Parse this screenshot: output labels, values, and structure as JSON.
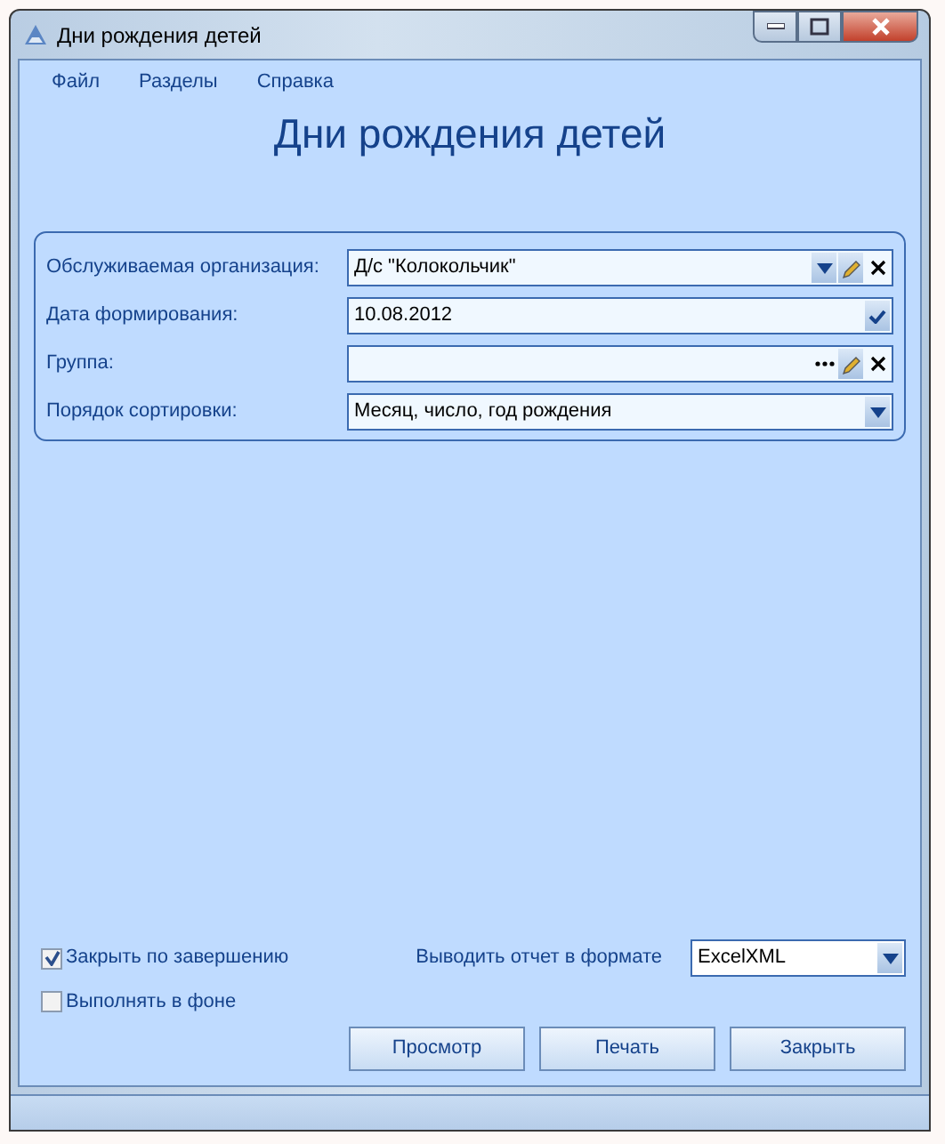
{
  "window": {
    "title": "Дни рождения детей"
  },
  "menu": [
    {
      "label": "Файл"
    },
    {
      "label": "Разделы"
    },
    {
      "label": "Справка"
    }
  ],
  "heading": "Дни рождения детей",
  "fields": [
    {
      "label": "Обслуживаемая организация:",
      "value": "Д/с \"Колокольчик\"",
      "buttons": [
        {
          "kind": "dropdown"
        },
        {
          "kind": "edit"
        },
        {
          "kind": "clear"
        }
      ]
    },
    {
      "label": "Дата формирования:",
      "value": "10.08.2012",
      "buttons": [
        {
          "kind": "check"
        }
      ]
    },
    {
      "label": "Группа:",
      "buttons": [
        {
          "kind": "ellipsis"
        },
        {
          "kind": "edit"
        },
        {
          "kind": "clear"
        }
      ]
    },
    {
      "label": "Порядок сортировки:",
      "value": "Месяц, число, год рождения",
      "buttons": [
        {
          "kind": "dropdown"
        }
      ]
    }
  ],
  "options": [
    {
      "label": "Закрыть по завершению",
      "checked": true
    },
    {
      "label": "Выполнять в фоне",
      "checked": false
    }
  ],
  "format": {
    "label": "Выводить отчет в формате",
    "value": "ExcelXML"
  },
  "buttons": [
    {
      "label": "Просмотр"
    },
    {
      "label": "Печать"
    },
    {
      "label": "Закрыть"
    }
  ]
}
